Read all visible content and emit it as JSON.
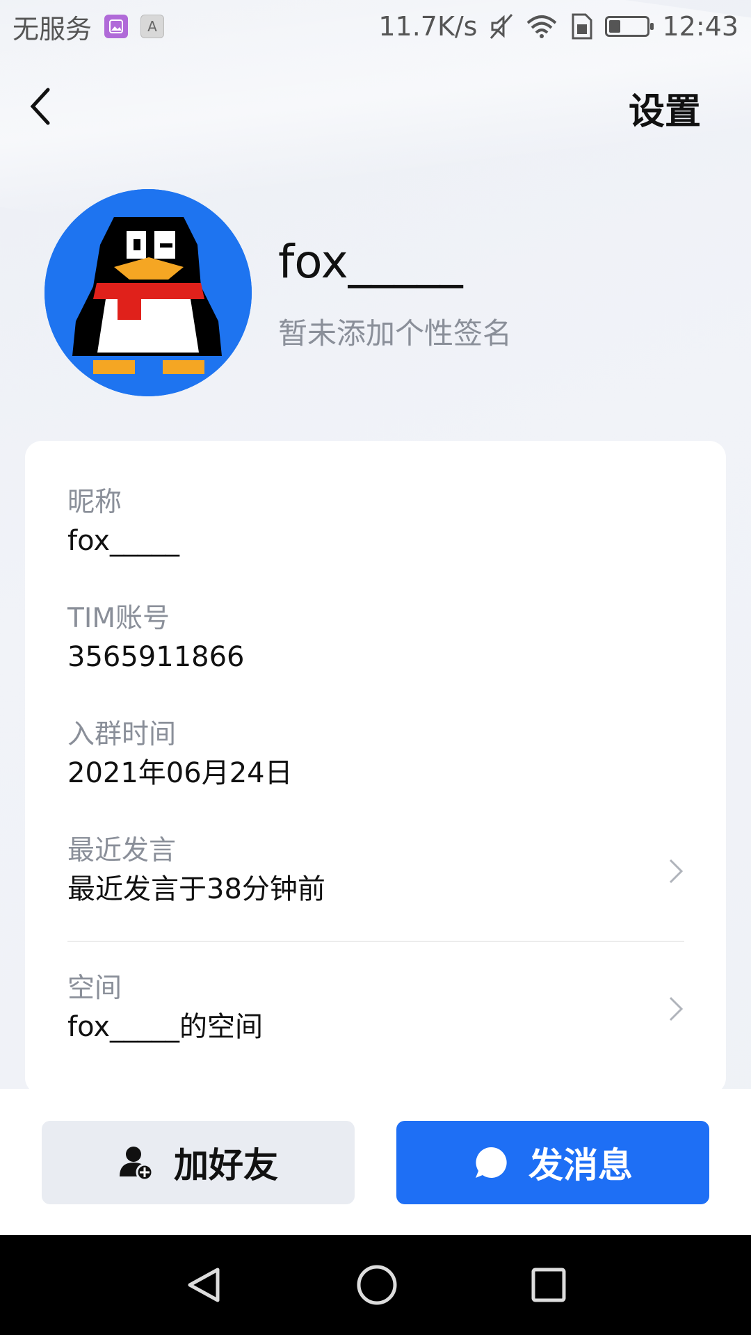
{
  "status_bar": {
    "carrier": "无服务",
    "network_speed": "11.7K/s",
    "time": "12:43",
    "chip_grey_letter": "A"
  },
  "header": {
    "settings_label": "设置"
  },
  "profile": {
    "name": "fox_____",
    "signature": "暂未添加个性签名"
  },
  "fields": {
    "nickname": {
      "label": "昵称",
      "value": "fox_____"
    },
    "tim_account": {
      "label": "TIM账号",
      "value": "3565911866"
    },
    "join_time": {
      "label": "入群时间",
      "value": "2021年06月24日"
    },
    "last_speech": {
      "label": "最近发言",
      "value": "最近发言于38分钟前"
    },
    "space": {
      "label": "空间",
      "value": "fox_____的空间"
    }
  },
  "actions": {
    "add_friend_label": "加好友",
    "send_message_label": "发消息"
  },
  "colors": {
    "accent": "#1e6ff5",
    "avatar_bg": "#1e74f0",
    "label_grey": "#8a8f99"
  }
}
